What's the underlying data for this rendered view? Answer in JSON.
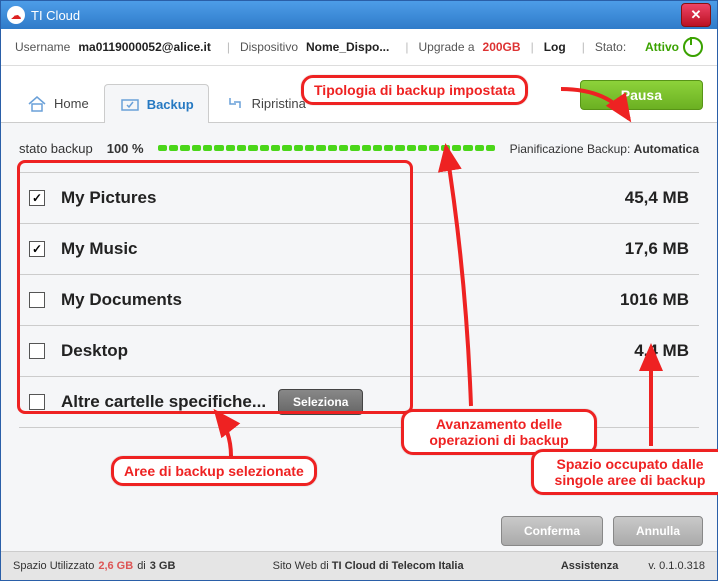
{
  "window": {
    "title": "TI Cloud"
  },
  "toolbar": {
    "username_label": "Username",
    "username": "ma0119000052@alice.it",
    "device_label": "Dispositivo",
    "device": "Nome_Dispo...",
    "upgrade_label": "Upgrade a",
    "upgrade": "200GB",
    "log": "Log",
    "state_label": "Stato:",
    "state": "Attivo"
  },
  "tabs": {
    "home": "Home",
    "backup": "Backup",
    "restore": "Ripristina"
  },
  "pause_btn": "Pausa",
  "status": {
    "label": "stato backup",
    "percent": "100 %",
    "plan_label": "Pianificazione Backup:",
    "plan_value": "Automatica"
  },
  "folders": [
    {
      "name": "My Pictures",
      "checked": true,
      "size": "45,4 MB"
    },
    {
      "name": "My Music",
      "checked": true,
      "size": "17,6 MB"
    },
    {
      "name": "My Documents",
      "checked": false,
      "size": "1016 MB"
    },
    {
      "name": "Desktop",
      "checked": false,
      "size": "4,4 MB"
    },
    {
      "name": "Altre cartelle specifiche...",
      "checked": false,
      "size": "",
      "has_select": true
    }
  ],
  "select_label": "Seleziona",
  "actions": {
    "confirm": "Conferma",
    "cancel": "Annulla"
  },
  "footer": {
    "space_label": "Spazio Utilizzato",
    "used": "2,6 GB",
    "of": "di",
    "total": "3 GB",
    "site_label": "Sito Web di",
    "site": "TI Cloud di Telecom Italia",
    "assist": "Assistenza",
    "version": "v. 0.1.0.318"
  },
  "callouts": {
    "c1": "Tipologia di backup impostata",
    "c2": "Avanzamento delle\noperazioni di backup",
    "c3": "Spazio occupato dalle\nsingole aree di backup",
    "c4": "Aree di backup selezionate"
  }
}
